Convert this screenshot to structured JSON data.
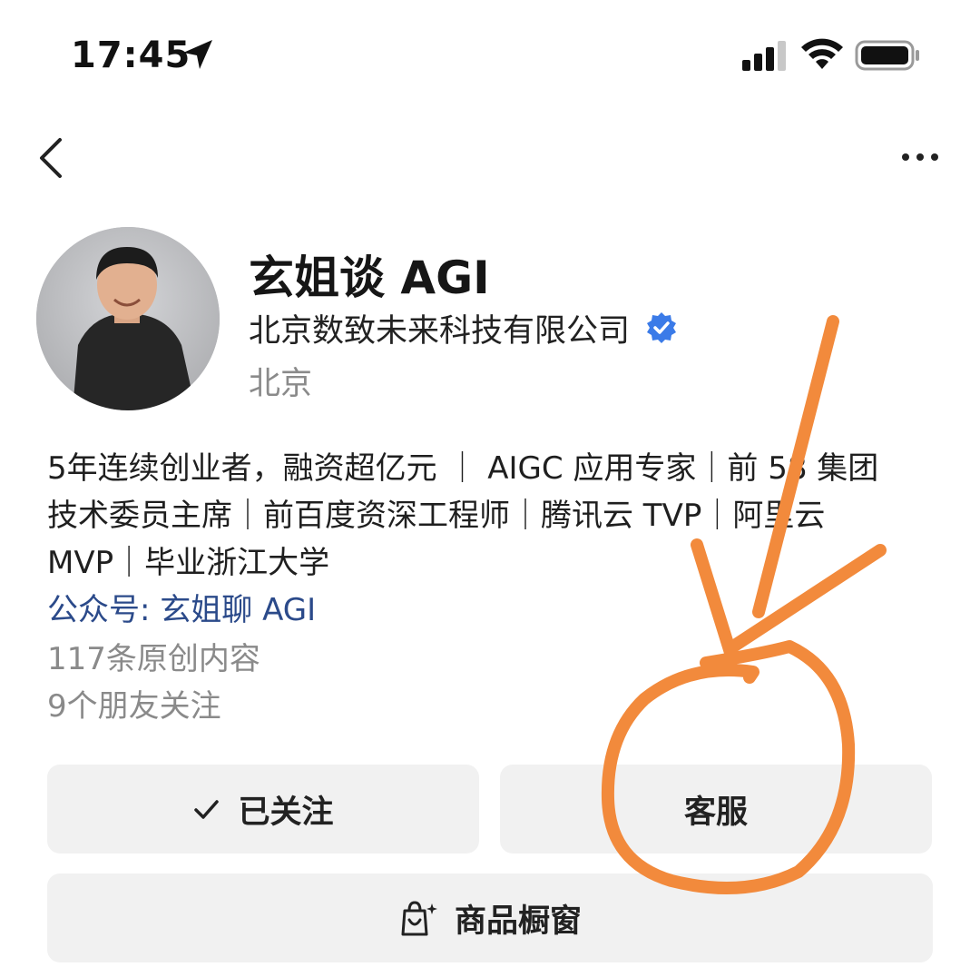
{
  "status_bar": {
    "time": "17:45"
  },
  "nav": {
    "back_icon": "chevron-left-icon",
    "more_icon": "more-horizontal-icon"
  },
  "profile": {
    "name": "玄姐谈 AGI",
    "company": "北京数致未来科技有限公司",
    "city": "北京",
    "bio_lines": [
      "5年连续创业者，融资超亿元 ｜ AIGC 应用专家｜前 58 集团",
      "技术委员主席｜前百度资深工程师｜腾讯云 TVP｜阿里云",
      "MVP｜毕业浙江大学"
    ],
    "gzh": "公众号: 玄姐聊 AGI",
    "posts": "117条原创内容",
    "friends": "9个朋友关注"
  },
  "buttons": {
    "follow": "已关注",
    "service": "客服",
    "shop": "商品橱窗"
  },
  "colors": {
    "verified": "#3b7be8",
    "annotation": "#f28a3c",
    "link": "#2b4a8a",
    "button_bg": "#f1f1f1"
  }
}
